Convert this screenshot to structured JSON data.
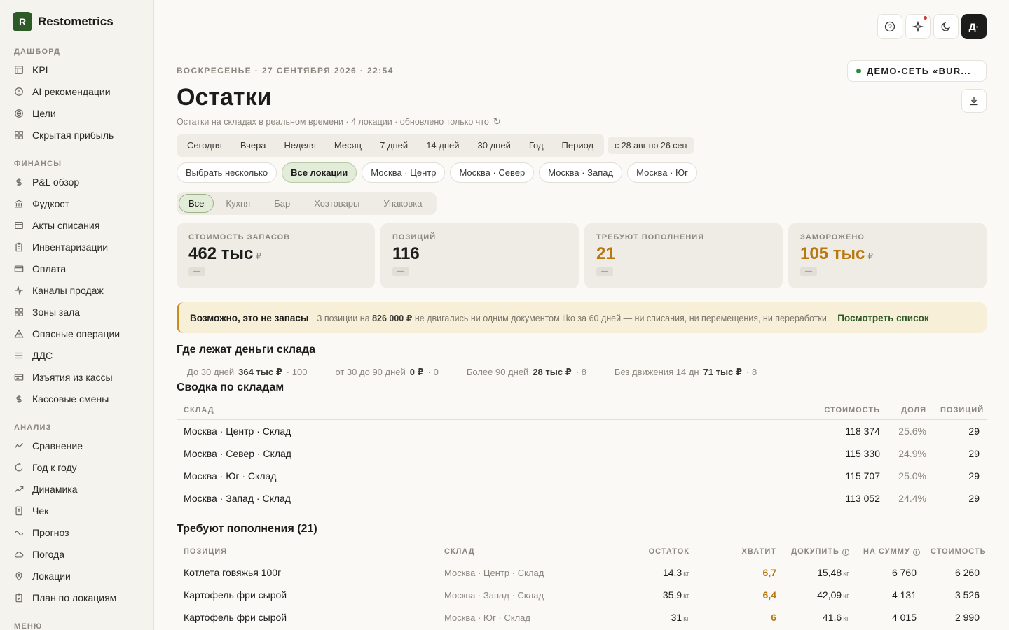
{
  "brand": {
    "logo": "R",
    "name": "Restometrics"
  },
  "sidebar": {
    "sections": [
      {
        "label": "ДАШБОРД",
        "items": [
          {
            "label": "KPI",
            "icon": "table-icon"
          },
          {
            "label": "AI рекомендации",
            "icon": "alert-circle-icon"
          },
          {
            "label": "Цели",
            "icon": "target-icon"
          },
          {
            "label": "Скрытая прибыль",
            "icon": "grid-icon"
          }
        ]
      },
      {
        "label": "ФИНАНСЫ",
        "items": [
          {
            "label": "P&L обзор",
            "icon": "dollar-icon"
          },
          {
            "label": "Фудкост",
            "icon": "bank-icon"
          },
          {
            "label": "Акты списания",
            "icon": "document-icon"
          },
          {
            "label": "Инвентаризации",
            "icon": "clipboard-icon"
          },
          {
            "label": "Оплата",
            "icon": "card-icon"
          },
          {
            "label": "Каналы продаж",
            "icon": "pulse-icon"
          },
          {
            "label": "Зоны зала",
            "icon": "grid-icon"
          },
          {
            "label": "Опасные операции",
            "icon": "warning-icon"
          },
          {
            "label": "ДДС",
            "icon": "menu-icon"
          },
          {
            "label": "Изъятия из кассы",
            "icon": "register-icon"
          },
          {
            "label": "Кассовые смены",
            "icon": "dollar-icon"
          }
        ]
      },
      {
        "label": "АНАЛИЗ",
        "items": [
          {
            "label": "Сравнение",
            "icon": "compare-icon"
          },
          {
            "label": "Год к году",
            "icon": "refresh-icon"
          },
          {
            "label": "Динамика",
            "icon": "trend-icon"
          },
          {
            "label": "Чек",
            "icon": "receipt-icon"
          },
          {
            "label": "Прогноз",
            "icon": "wave-icon"
          },
          {
            "label": "Погода",
            "icon": "cloud-icon"
          },
          {
            "label": "Локации",
            "icon": "pin-icon"
          },
          {
            "label": "План по локациям",
            "icon": "clipboard-check-icon"
          }
        ]
      },
      {
        "label": "МЕНЮ",
        "items": []
      }
    ]
  },
  "topbar": {
    "avatar": "Д·"
  },
  "header": {
    "date": "ВОСКРЕСЕНЬЕ · 27 СЕНТЯБРЯ 2026 · 22:54",
    "org": "ДЕМО-СЕТЬ «BUR...",
    "title": "Остатки",
    "subtitle": "Остатки на складах в реальном времени · 4 локации · обновлено только что",
    "refresh": "↻"
  },
  "periods": [
    "Сегодня",
    "Вчера",
    "Неделя",
    "Месяц",
    "7 дней",
    "14 дней",
    "30 дней",
    "Год",
    "Период"
  ],
  "range": "с 28 авг по 26 сен",
  "locations": [
    "Выбрать несколько",
    "Все локации",
    "Москва · Центр",
    "Москва · Север",
    "Москва · Запад",
    "Москва · Юг"
  ],
  "categories": [
    "Все",
    "Кухня",
    "Бар",
    "Хозтовары",
    "Упаковка"
  ],
  "kpis": [
    {
      "label": "СТОИМОСТЬ ЗАПАСОВ",
      "value": "462 тыс",
      "unit": "₽",
      "delta": "—"
    },
    {
      "label": "ПОЗИЦИЙ",
      "value": "116",
      "unit": "",
      "delta": "—"
    },
    {
      "label": "ТРЕБУЮТ ПОПОЛНЕНИЯ",
      "value": "21",
      "unit": "",
      "delta": "—"
    },
    {
      "label": "ЗАМОРОЖЕНО",
      "value": "105 тыс",
      "unit": "₽",
      "delta": "—"
    }
  ],
  "alert": {
    "title": "Возможно, это не запасы",
    "pre": "3 позиции на",
    "amount": "826 000 ₽",
    "post": "не двигались ни одним документом iiko за 60 дней — ни списания, ни перемещения, ни переработки.",
    "link": "Посмотреть список"
  },
  "aging": {
    "title": "Где лежат деньги склада",
    "items": [
      {
        "label": "До 30 дней",
        "amount": "364 тыс ₽",
        "count": "· 100"
      },
      {
        "label": "от 30 до 90 дней",
        "amount": "0 ₽",
        "count": "· 0"
      },
      {
        "label": "Более 90 дней",
        "amount": "28 тыс ₽",
        "count": "· 8"
      },
      {
        "label": "Без движения 14 дн",
        "amount": "71 тыс ₽",
        "count": "· 8"
      }
    ]
  },
  "summary": {
    "title": "Сводка по складам",
    "headers": [
      "СКЛАД",
      "СТОИМОСТЬ",
      "ДОЛЯ",
      "ПОЗИЦИЙ"
    ],
    "rows": [
      [
        "Москва · Центр · Склад",
        "118 374",
        "25.6%",
        "29"
      ],
      [
        "Москва · Север · Склад",
        "115 330",
        "24.9%",
        "29"
      ],
      [
        "Москва · Юг · Склад",
        "115 707",
        "25.0%",
        "29"
      ],
      [
        "Москва · Запад · Склад",
        "113 052",
        "24.4%",
        "29"
      ]
    ]
  },
  "restock": {
    "title": "Требуют пополнения (21)",
    "headers": [
      "ПОЗИЦИЯ",
      "СКЛАД",
      "ОСТАТОК",
      "ХВАТИТ",
      "ДОКУПИТЬ",
      "НА СУММУ",
      "СТОИМОСТЬ"
    ],
    "info": "i",
    "rows": [
      [
        "Котлета говяжья 100г",
        "Москва · Центр · Склад",
        "14,3",
        "кг",
        "6,7",
        "15,48",
        "кг",
        "6 760",
        "6 260"
      ],
      [
        "Картофель фри сырой",
        "Москва · Запад · Склад",
        "35,9",
        "кг",
        "6,4",
        "42,09",
        "кг",
        "4 131",
        "3 526"
      ],
      [
        "Картофель фри сырой",
        "Москва · Юг · Склад",
        "31",
        "кг",
        "6",
        "41,6",
        "кг",
        "4 015",
        "2 990"
      ]
    ]
  },
  "colors": {
    "brand": "#2d5a27",
    "amber": "#b8780f",
    "alert_bg": "#f8efd8",
    "active_pill": "#e3ebd9"
  }
}
